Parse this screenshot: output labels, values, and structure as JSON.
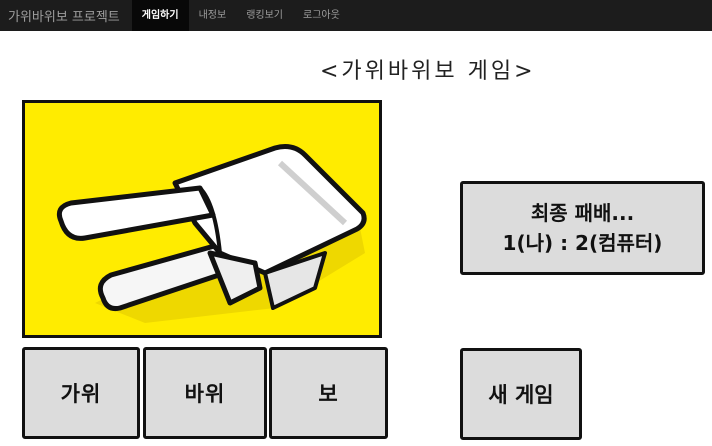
{
  "navbar": {
    "brand": "가위바위보 프로젝트",
    "items": [
      {
        "label": "게임하기",
        "active": true
      },
      {
        "label": "내정보",
        "active": false
      },
      {
        "label": "랭킹보기",
        "active": false
      },
      {
        "label": "로그아웃",
        "active": false
      }
    ]
  },
  "game": {
    "title": "<가위바위보  게임>",
    "displayed_hand": "scissors-hand-icon",
    "choices": {
      "scissors": "가위",
      "rock": "바위",
      "paper": "보"
    },
    "result": {
      "title": "최종 패배...",
      "score": "1(나) : 2(컴퓨터)"
    },
    "new_game": "새 게임"
  },
  "colors": {
    "navbar_bg": "#1c1c1c",
    "panel_yellow": "#ffec00",
    "button_gray": "#dcdcdc"
  }
}
